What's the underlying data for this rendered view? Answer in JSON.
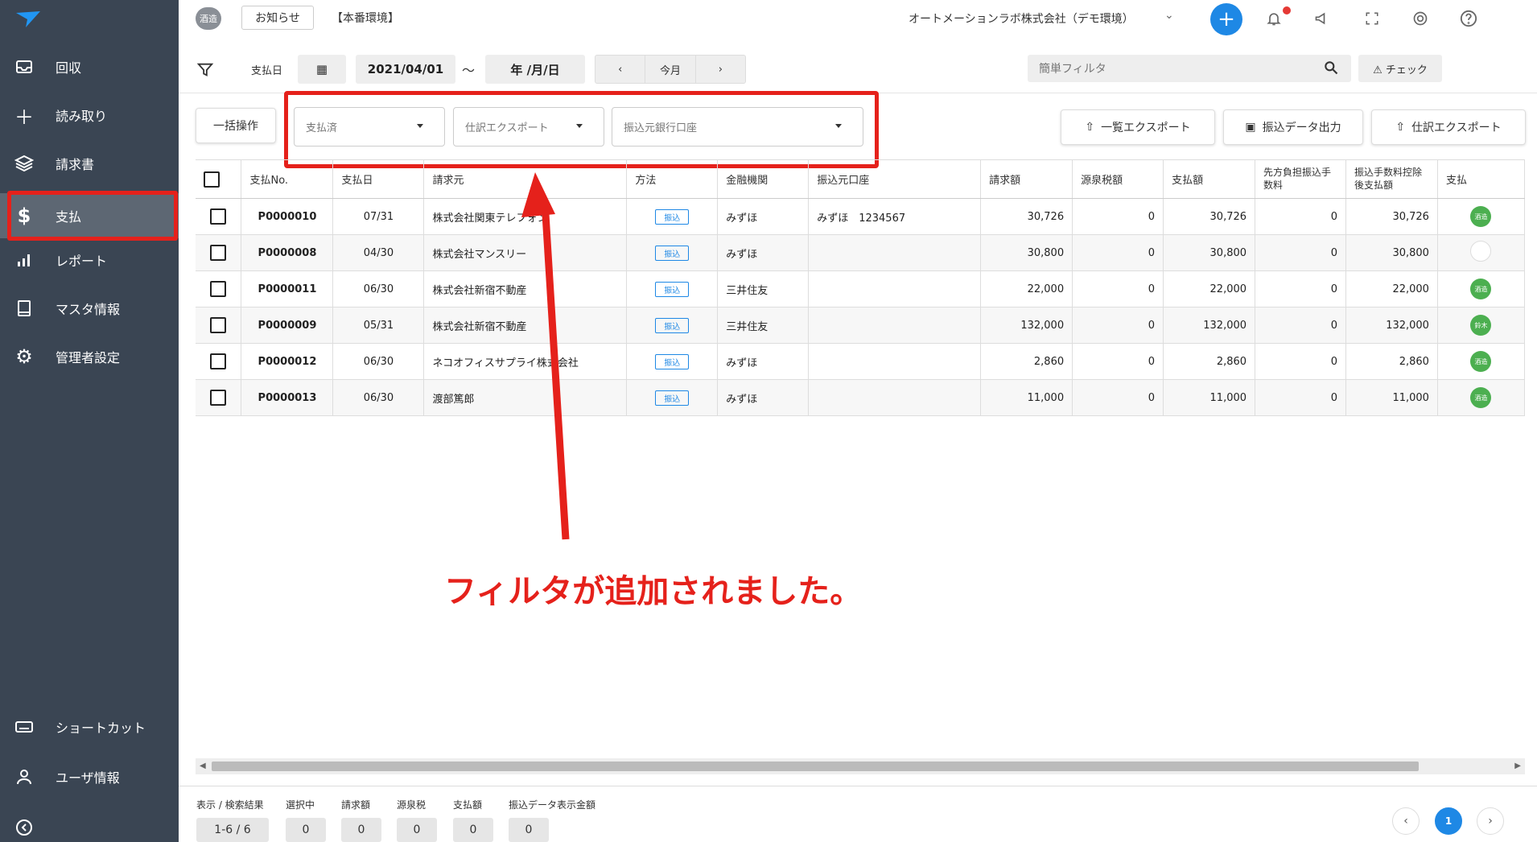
{
  "sidebar": {
    "items": [
      {
        "label": "回収",
        "icon": "inbox-icon"
      },
      {
        "label": "読み取り",
        "icon": "plus-icon"
      },
      {
        "label": "請求書",
        "icon": "layers-icon"
      },
      {
        "label": "支払",
        "icon": "dollar-icon"
      },
      {
        "label": "レポート",
        "icon": "bar-chart-icon"
      },
      {
        "label": "マスタ情報",
        "icon": "book-icon"
      },
      {
        "label": "管理者設定",
        "icon": "gear-icon"
      }
    ],
    "bottom": [
      {
        "label": "ショートカット",
        "icon": "keyboard-icon"
      },
      {
        "label": "ユーザ情報",
        "icon": "user-icon"
      }
    ]
  },
  "topbar": {
    "env_badge": "酒造",
    "notice": "お知らせ",
    "env_label": "【本番環境】",
    "company": "オートメーションラボ株式会社（デモ環境）"
  },
  "filter": {
    "date_label": "支払日",
    "date_from": "2021/04/01",
    "tilde": "～",
    "date_to": "年 /月/日",
    "nav": [
      "‹",
      "今月",
      "›"
    ],
    "search_placeholder": "簡単フィルタ",
    "check": "⚠ チェック"
  },
  "toolbar": {
    "bulk": "一括操作",
    "selects": [
      "支払済",
      "仕訳エクスポート",
      "振込元銀行口座"
    ],
    "export_list": "一覧エクスポート",
    "transfer_out": "振込データ出力",
    "journal_export": "仕訳エクスポート"
  },
  "table": {
    "headers": [
      "支払No.",
      "支払日",
      "請求元",
      "方法",
      "金融機関",
      "振込元口座",
      "請求額",
      "源泉税額",
      "支払額",
      "先方負担振込手数料",
      "振込手数料控除後支払額",
      "支払"
    ],
    "rows": [
      {
        "no": "P0000010",
        "date": "07/31",
        "vendor": "株式会社関東テレフォン",
        "method": "振込",
        "bank": "みずほ",
        "account": "みずほ　1234567",
        "billed": "30,726",
        "tax": "0",
        "paid": "30,726",
        "fee": "0",
        "net": "30,726",
        "status": "酒造"
      },
      {
        "no": "P0000008",
        "date": "04/30",
        "vendor": "株式会社マンスリー",
        "method": "振込",
        "bank": "みずほ",
        "account": "",
        "billed": "30,800",
        "tax": "0",
        "paid": "30,800",
        "fee": "0",
        "net": "30,800",
        "status": ""
      },
      {
        "no": "P0000011",
        "date": "06/30",
        "vendor": "株式会社新宿不動産",
        "method": "振込",
        "bank": "三井住友",
        "account": "",
        "billed": "22,000",
        "tax": "0",
        "paid": "22,000",
        "fee": "0",
        "net": "22,000",
        "status": "酒造"
      },
      {
        "no": "P0000009",
        "date": "05/31",
        "vendor": "株式会社新宿不動産",
        "method": "振込",
        "bank": "三井住友",
        "account": "",
        "billed": "132,000",
        "tax": "0",
        "paid": "132,000",
        "fee": "0",
        "net": "132,000",
        "status": "鈴木"
      },
      {
        "no": "P0000012",
        "date": "06/30",
        "vendor": "ネコオフィスサプライ株式会社",
        "method": "振込",
        "bank": "みずほ",
        "account": "",
        "billed": "2,860",
        "tax": "0",
        "paid": "2,860",
        "fee": "0",
        "net": "2,860",
        "status": "酒造"
      },
      {
        "no": "P0000013",
        "date": "06/30",
        "vendor": "渡部篤郎",
        "method": "振込",
        "bank": "みずほ",
        "account": "",
        "billed": "11,000",
        "tax": "0",
        "paid": "11,000",
        "fee": "0",
        "net": "11,000",
        "status": "酒造"
      }
    ]
  },
  "footer": {
    "stats": [
      {
        "label": "表示 / 検索結果",
        "value": "1-6 / 6"
      },
      {
        "label": "選択中",
        "value": "0"
      },
      {
        "label": "請求額",
        "value": "0"
      },
      {
        "label": "源泉税",
        "value": "0"
      },
      {
        "label": "支払額",
        "value": "0"
      },
      {
        "label": "振込データ表示金額",
        "value": "0"
      }
    ],
    "page": "1"
  },
  "annotation": {
    "caption": "フィルタが追加されました。"
  },
  "colors": {
    "sidebar": "#3a4553",
    "accent": "#1e88e5",
    "annotation": "#e5211b",
    "status": "#4caf50"
  }
}
